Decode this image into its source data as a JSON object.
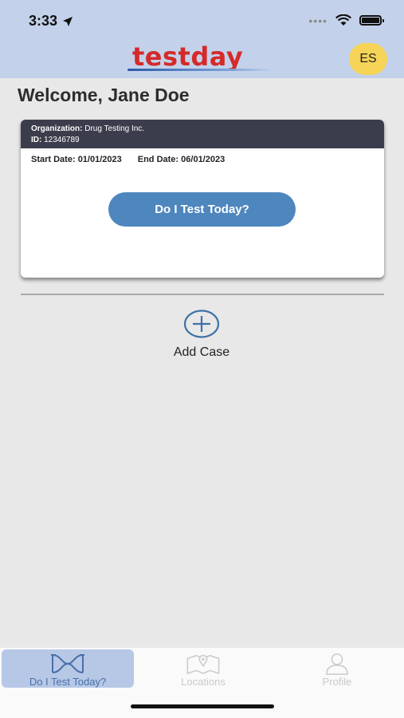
{
  "status_bar": {
    "time": "3:33"
  },
  "header": {
    "logo_text": "testday",
    "avatar_initials": "ES"
  },
  "welcome": "Welcome, Jane Doe",
  "case_card": {
    "org_label": "Organization:",
    "org_value": "Drug Testing Inc.",
    "id_label": "ID:",
    "id_value": "12346789",
    "start_label": "Start Date:",
    "start_value": "01/01/2023",
    "end_label": "End Date:",
    "end_value": "06/01/2023",
    "button_label": "Do I Test Today?"
  },
  "add_case_label": "Add Case",
  "tabs": [
    {
      "label": "Do I Test Today?",
      "icon": "test-today-icon",
      "active": true
    },
    {
      "label": "Locations",
      "icon": "map-pin-icon",
      "active": false
    },
    {
      "label": "Profile",
      "icon": "person-icon",
      "active": false
    }
  ],
  "colors": {
    "header_bg": "#c3d2ea",
    "logo_red": "#d42a2a",
    "avatar_yellow": "#f6d458",
    "button_blue": "#4e86be",
    "card_header": "#3c3d4c"
  }
}
